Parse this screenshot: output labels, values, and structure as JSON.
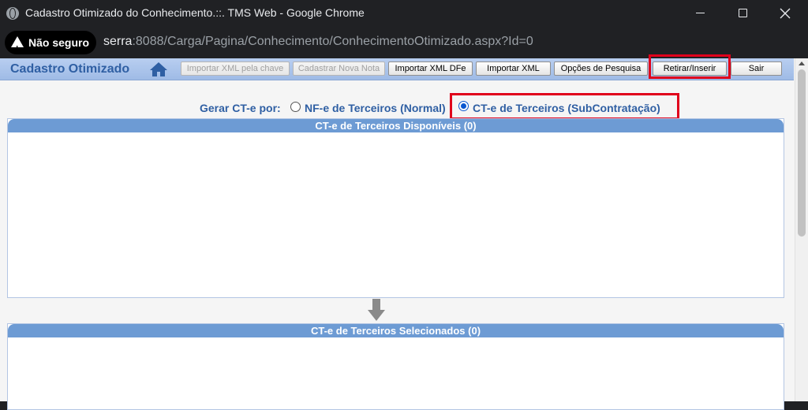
{
  "window": {
    "title": "Cadastro Otimizado do Conhecimento.::. TMS Web - Google Chrome"
  },
  "addressbar": {
    "security_label": "Não seguro",
    "host": "serra",
    "path": ":8088/Carga/Pagina/Conhecimento/ConhecimentoOtimizado.aspx?Id=0"
  },
  "header": {
    "title": "Cadastro Otimizado",
    "buttons": [
      {
        "label": "Importar XML pela chave",
        "enabled": false
      },
      {
        "label": "Cadastrar Nova Nota",
        "enabled": false
      },
      {
        "label": "Importar XML DFe",
        "enabled": true
      },
      {
        "label": "Importar XML",
        "enabled": true
      },
      {
        "label": "Opções de Pesquisa",
        "enabled": true
      },
      {
        "label": "Retirar/Inserir",
        "enabled": true
      },
      {
        "label": "Sair",
        "enabled": true
      }
    ]
  },
  "generation": {
    "label": "Gerar CT-e por:",
    "options": [
      {
        "label": "NF-e de Terceiros (Normal)",
        "selected": false
      },
      {
        "label": "CT-e de Terceiros (SubContratação)",
        "selected": true
      }
    ]
  },
  "panels": {
    "available_title": "CT-e de Terceiros Disponíveis (0)",
    "selected_title": "CT-e de Terceiros Selecionados (0)"
  },
  "colors": {
    "highlight": "#e0001b",
    "header_blue": "#2f5fa3",
    "panel_head": "#6d9bd4"
  }
}
